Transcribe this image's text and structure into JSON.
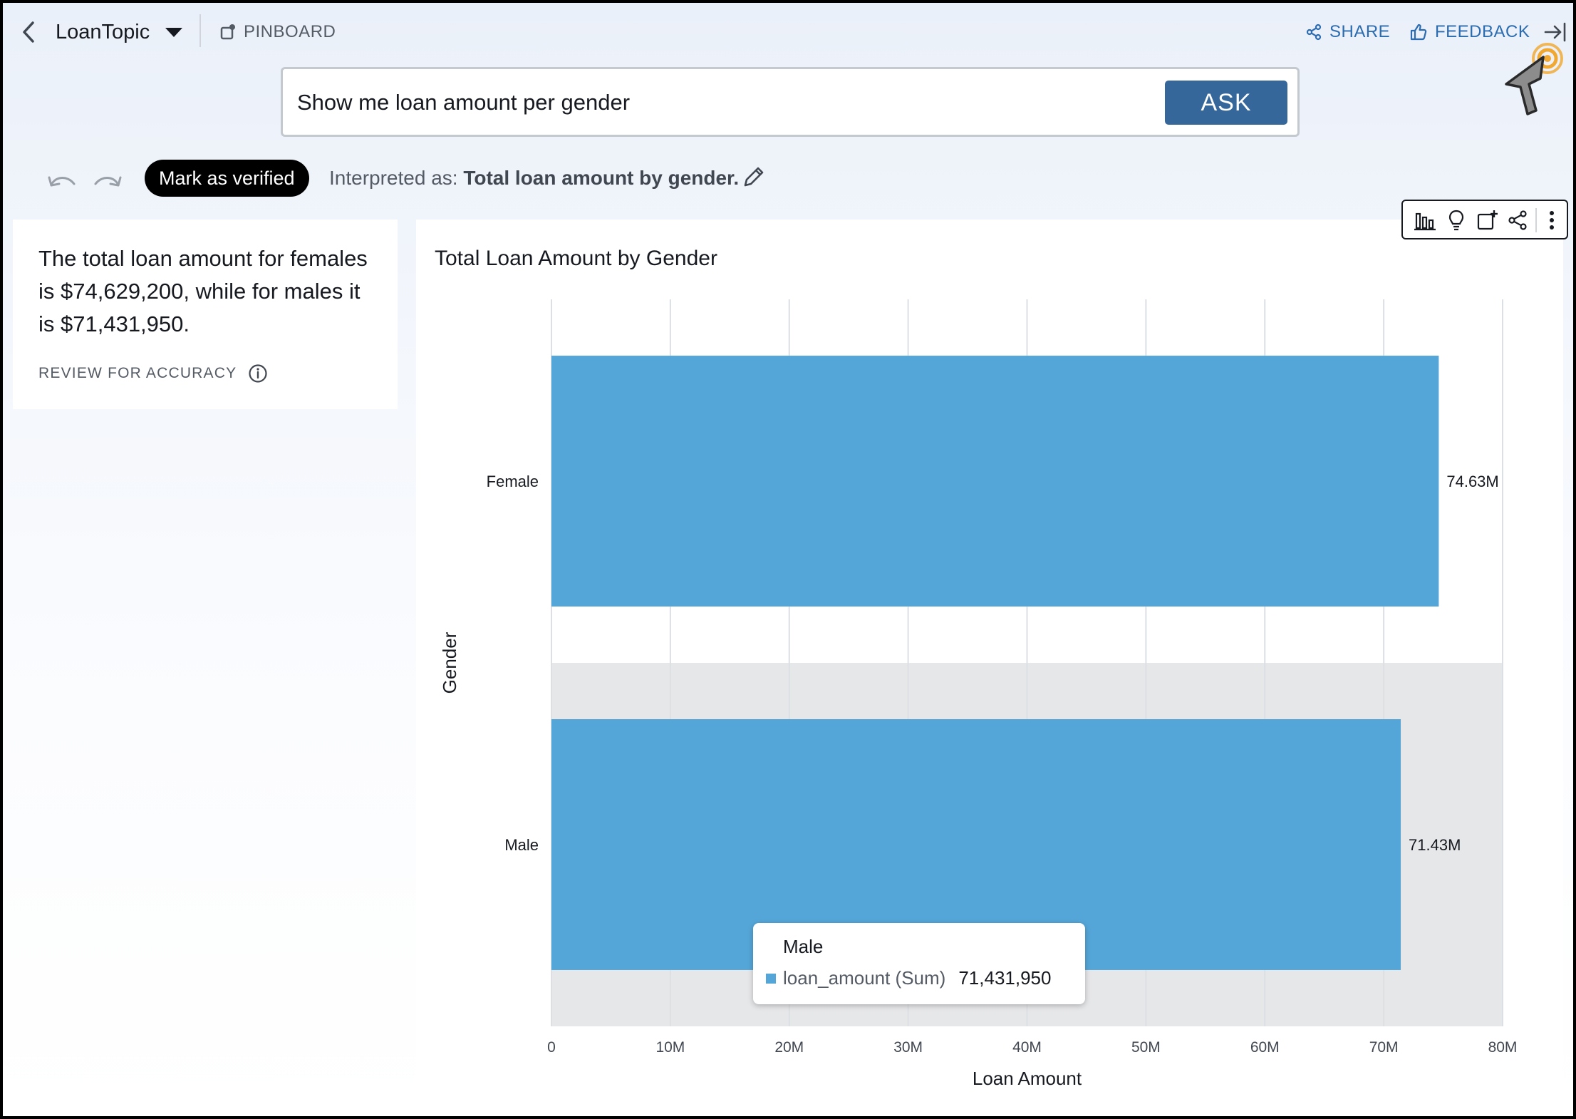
{
  "header": {
    "topic": "LoanTopic",
    "pinboard_label": "PINBOARD",
    "share_label": "SHARE",
    "feedback_label": "FEEDBACK"
  },
  "ask": {
    "query": "Show me loan amount per gender",
    "button_label": "ASK"
  },
  "interpretation": {
    "verify_label": "Mark as verified",
    "prefix": "Interpreted as:",
    "text": "Total loan amount by gender."
  },
  "summary": {
    "text": "The total loan amount for females is $74,629,200, while for males it is $71,431,950.",
    "review_label": "REVIEW FOR ACCURACY"
  },
  "icons": {
    "back": "chevron-left-icon",
    "topic_dropdown": "caret-down-icon",
    "pinboard": "pinboard-icon",
    "share": "share-icon",
    "feedback": "thumbs-up-icon",
    "collapse": "collapse-panel-icon",
    "undo": "undo-icon",
    "redo": "redo-icon",
    "edit": "pencil-icon",
    "info": "info-icon",
    "toolbar": [
      "bar-chart-icon",
      "lightbulb-icon",
      "add-to-pinboard-icon",
      "share-icon",
      "more-vertical-icon"
    ],
    "cursor": "mouse-pointer-icon"
  },
  "colors": {
    "accent": "#2b6cb0",
    "ask_button": "#35679a",
    "bar": "#55a6d8",
    "cursor_highlight": "#f0a830"
  },
  "chart_data": {
    "type": "bar",
    "orientation": "horizontal",
    "title": "Total Loan Amount by Gender",
    "xlabel": "Loan Amount",
    "ylabel": "Gender",
    "categories": [
      "Female",
      "Male"
    ],
    "series": [
      {
        "name": "loan_amount (Sum)",
        "values": [
          74629200,
          71431950
        ]
      }
    ],
    "data_labels": [
      "74.63M",
      "71.43M"
    ],
    "xlim": [
      0,
      80000000
    ],
    "xticks": [
      0,
      10000000,
      20000000,
      30000000,
      40000000,
      50000000,
      60000000,
      70000000,
      80000000
    ],
    "xtick_labels": [
      "0",
      "10M",
      "20M",
      "30M",
      "40M",
      "50M",
      "60M",
      "70M",
      "80M"
    ],
    "grid": true,
    "highlighted_category": "Male"
  },
  "tooltip": {
    "title": "Male",
    "label": "loan_amount (Sum)",
    "value": "71,431,950"
  }
}
